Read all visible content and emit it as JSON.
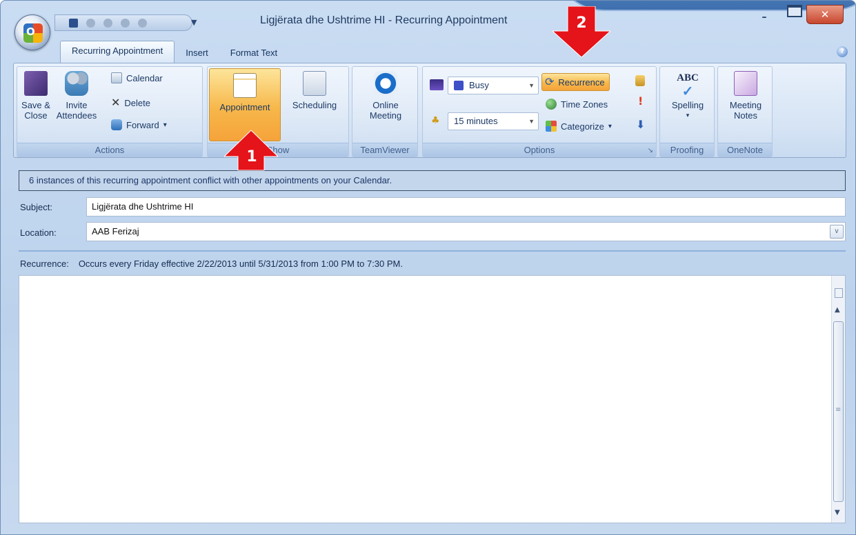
{
  "window": {
    "title": "Ligjërata dhe Ushtrime HI - Recurring Appointment",
    "app_button_letter": "O",
    "minimize_glyph": "–",
    "close_glyph": "✕",
    "qat_dropdown_glyph": "▼",
    "help_glyph": "?"
  },
  "tabs": [
    {
      "label": "Recurring Appointment",
      "active": true
    },
    {
      "label": "Insert",
      "active": false
    },
    {
      "label": "Format Text",
      "active": false
    }
  ],
  "ribbon": {
    "actions": {
      "group_label": "Actions",
      "save_close": "Save &\nClose",
      "invite_attendees": "Invite\nAttendees",
      "calendar": "Calendar",
      "delete": "Delete",
      "delete_icon_glyph": "✕",
      "forward": "Forward",
      "forward_caret": "▾"
    },
    "show": {
      "group_label": "Show",
      "appointment": "Appointment",
      "scheduling": "Scheduling"
    },
    "teamviewer": {
      "group_label": "TeamViewer",
      "online_meeting": "Online\nMeeting"
    },
    "options": {
      "group_label": "Options",
      "show_as_value": "Busy",
      "reminder_value": "15 minutes",
      "recurrence": "Recurrence",
      "time_zones": "Time Zones",
      "categorize": "Categorize",
      "categorize_caret": "▾",
      "high_importance_glyph": "!",
      "low_importance_glyph": "⬇",
      "launcher_glyph": "↘"
    },
    "proofing": {
      "group_label": "Proofing",
      "spelling": "Spelling",
      "spelling_caret": "▾",
      "abc": "ABC"
    },
    "onenote": {
      "group_label": "OneNote",
      "meeting_notes": "Meeting\nNotes"
    }
  },
  "info_bar": "6 instances of this recurring appointment conflict with other appointments on your Calendar.",
  "form": {
    "subject_label": "Subject:",
    "subject_value": "Ligjërata dhe Ushtrime HI",
    "location_label": "Location:",
    "location_value": "AAB Ferizaj",
    "location_arrow_glyph": "v",
    "recurrence_label": "Recurrence:",
    "recurrence_value": "Occurs every Friday effective 2/22/2013 until 5/31/2013 from 1:00 PM to 7:30 PM."
  },
  "scrollbar": {
    "up_glyph": "▲",
    "down_glyph": "▼",
    "grip_glyph": "≡"
  },
  "callouts": [
    {
      "number": "1"
    },
    {
      "number": "2"
    }
  ],
  "colors": {
    "callout_red": "#e5131a",
    "highlight_orange": "#f7b74a",
    "info_bar_bg": "#c4d6ec"
  }
}
